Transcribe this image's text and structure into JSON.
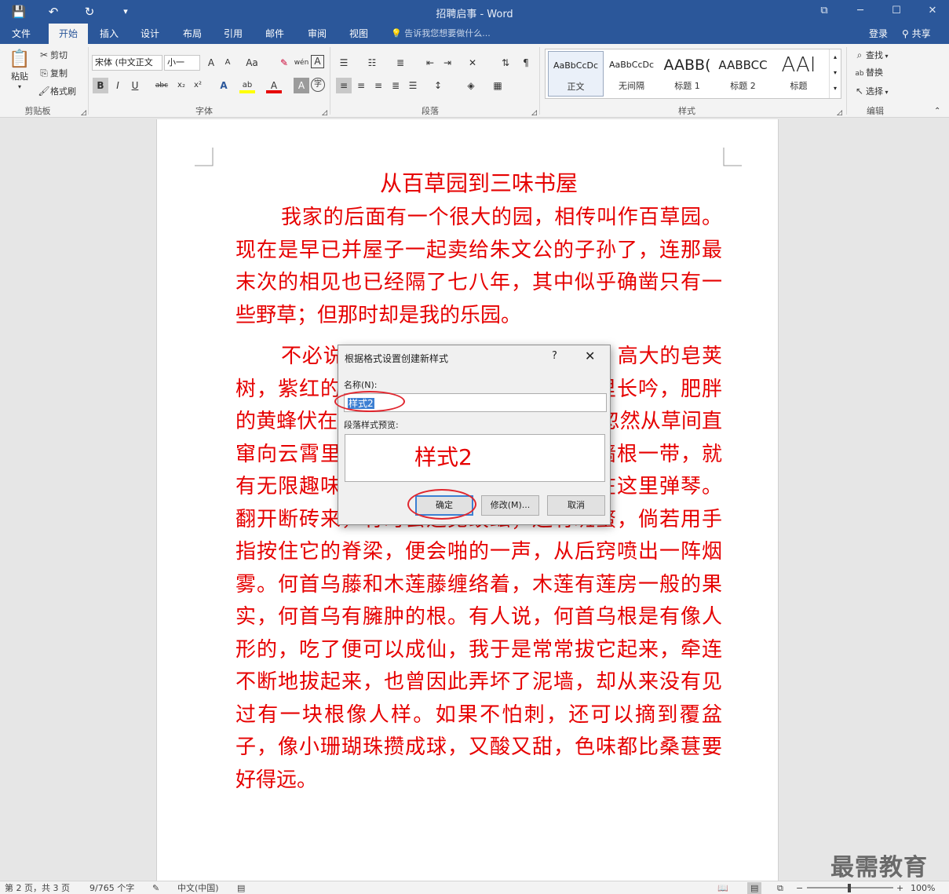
{
  "window": {
    "title": "招聘启事 - Word",
    "controls": {
      "ribbon_opts": "⧉",
      "minimize": "─",
      "maximize": "☐",
      "close": "✕"
    }
  },
  "quick_access": {
    "save": "💾",
    "undo": "↶",
    "redo": "↻",
    "customize": "▾"
  },
  "tabs": [
    {
      "label": "文件"
    },
    {
      "label": "开始"
    },
    {
      "label": "插入"
    },
    {
      "label": "设计"
    },
    {
      "label": "布局"
    },
    {
      "label": "引用"
    },
    {
      "label": "邮件"
    },
    {
      "label": "审阅"
    },
    {
      "label": "视图"
    }
  ],
  "tell_me": "告诉我您想要做什么...",
  "account": {
    "login": "登录",
    "share": "共享"
  },
  "clipboard": {
    "paste": "粘贴",
    "cut": "剪切",
    "copy": "复制",
    "format_painter": "格式刷",
    "label": "剪贴板"
  },
  "font": {
    "name": "宋体 (中文正文",
    "size": "小一",
    "grow": "A",
    "shrink": "A",
    "case": "Aa",
    "clear": "✎",
    "phonetic": "wén",
    "border": "A",
    "bold": "B",
    "italic": "I",
    "underline": "U",
    "strike": "abc",
    "sub": "x₂",
    "sup": "x²",
    "effects": "A",
    "highlight": "ab",
    "color": "A",
    "shade": "A",
    "enclose": "字",
    "label": "字体"
  },
  "paragraph": {
    "label": "段落"
  },
  "styles": {
    "label": "样式",
    "items": [
      {
        "preview": "AaBbCcDc",
        "name": "正文"
      },
      {
        "preview": "AaBbCcDc",
        "name": "无间隔"
      },
      {
        "preview": "AABB(",
        "name": "标题 1"
      },
      {
        "preview": "AABBCC",
        "name": "标题 2"
      },
      {
        "preview": "AAI",
        "name": "标题"
      }
    ]
  },
  "editing": {
    "find": "查找",
    "replace": "替换",
    "select": "选择",
    "label": "编辑"
  },
  "document": {
    "title": "从百草园到三味书屋",
    "para1": "我家的后面有一个很大的园，相传叫作百草园。现在是早已并屋子一起卖给朱文公的子孙了，连那最末次的相见也已经隔了七八年，其中似乎确凿只有一些野草；但那时却是我的乐园。",
    "para2": "不必说碧绿的菜畦，光滑的石井栏，高大的皂荚树，紫红的桑葚；也不必说鸣蝉在树叶里长吟，肥胖的黄蜂伏在菜花上，轻捷的叫天子(云雀)忽然从草间直窜向云霄里去了。单是周围的短短的泥墙根一带，就有无限趣味。油蛉在这里低唱，蟋蟀们在这里弹琴。翻开断砖来，有时会遇见蜈蚣；还有斑蝥，倘若用手指按住它的脊梁，便会啪的一声，从后窍喷出一阵烟雾。何首乌藤和木莲藤缠络着，木莲有莲房一般的果实，何首乌有臃肿的根。有人说，何首乌根是有像人形的，吃了便可以成仙，我于是常常拔它起来，牵连不断地拔起来，也曾因此弄坏了泥墙，却从来没有见过有一块根像人样。如果不怕刺，还可以摘到覆盆子，像小珊瑚珠攒成球，又酸又甜，色味都比桑葚要好得远。"
  },
  "dialog": {
    "title": "根据格式设置创建新样式",
    "help": "?",
    "close": "✕",
    "name_label": "名称(N):",
    "name_value": "样式2",
    "preview_label": "段落样式预览:",
    "preview_text": "样式2",
    "ok": "确定",
    "modify": "修改(M)...",
    "cancel": "取消"
  },
  "status": {
    "page": "第 2 页，共 3 页",
    "words": "9/765 个字",
    "lang": "中文(中国)",
    "zoom": "100%"
  },
  "watermark": "最需教育",
  "colors": {
    "brand": "#2b579a",
    "doc_text": "#e60000",
    "annotation": "#e0262e"
  }
}
